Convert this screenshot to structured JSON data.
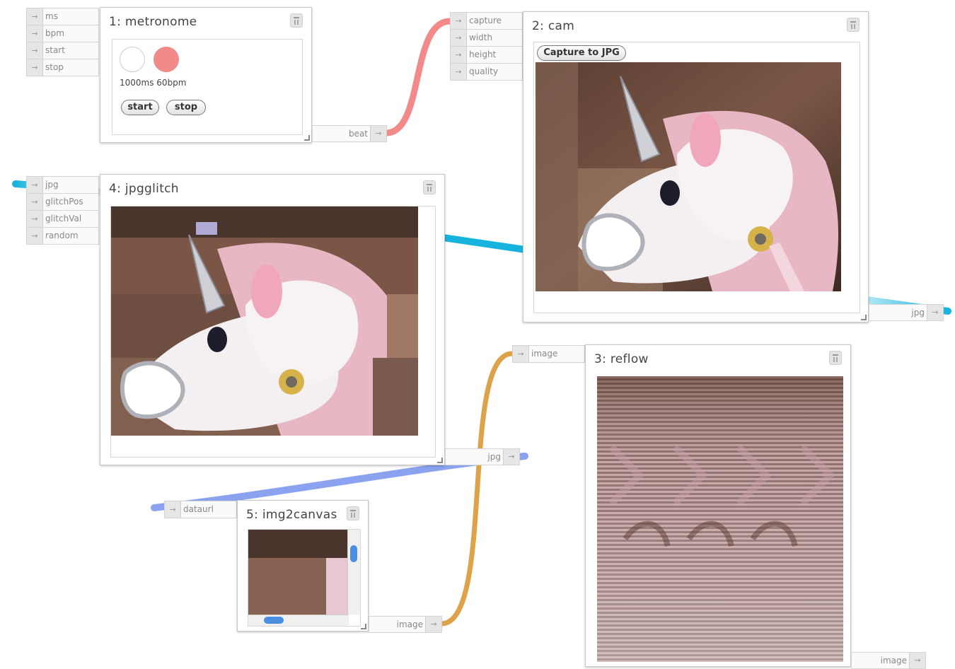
{
  "nodes": {
    "metronome": {
      "title": "1: metronome",
      "inports": [
        "ms",
        "bpm",
        "start",
        "stop"
      ],
      "outport": "beat",
      "status": "1000ms 60bpm",
      "start_label": "start",
      "stop_label": "stop"
    },
    "cam": {
      "title": "2: cam",
      "inports": [
        "capture",
        "width",
        "height",
        "quality"
      ],
      "outport": "jpg",
      "capture_label": "Capture to JPG"
    },
    "jpgglitch": {
      "title": "4: jpgglitch",
      "inports": [
        "jpg",
        "glitchPos",
        "glitchVal",
        "random"
      ],
      "outport": "jpg"
    },
    "reflow": {
      "title": "3: reflow",
      "inports": [
        "image"
      ],
      "outport": "image"
    },
    "img2canvas": {
      "title": "5: img2canvas",
      "inports": [
        "dataurl"
      ],
      "outport": "image"
    }
  },
  "colors": {
    "wire_beat": "#f28a8a",
    "wire_jpg_cam": "#16b3dd",
    "wire_jpg_glitch": "#8ba2ee",
    "wire_image": "#dea24a",
    "metronome_beat": "#f28a8a"
  },
  "icons": [
    "trash-icon",
    "port-arrow-icon",
    "resize-handle-icon"
  ]
}
